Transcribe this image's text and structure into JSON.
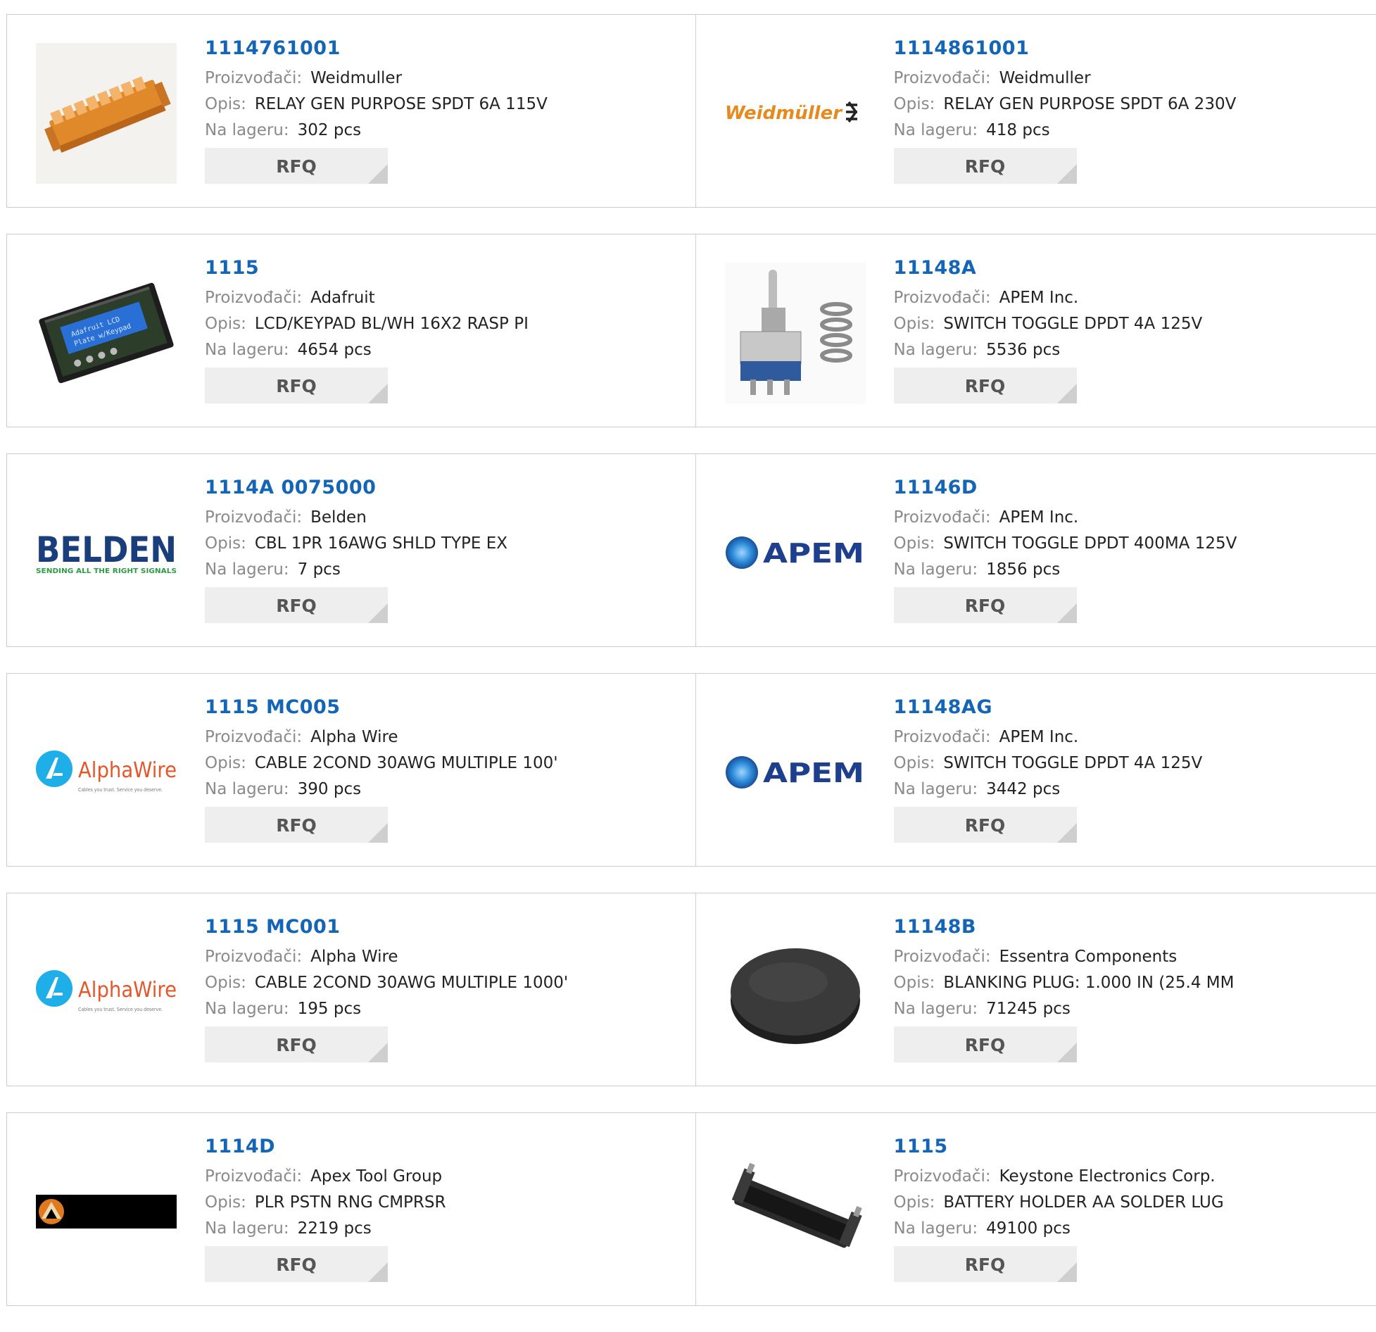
{
  "labels": {
    "manufacturer": "Proizvođači:",
    "description": "Opis:",
    "stock": "Na lageru:",
    "rfq": "RFQ"
  },
  "logos": {
    "weidmuller": "Weidmüller",
    "belden": "BELDEN",
    "belden_tagline": "SENDING ALL THE RIGHT SIGNALS",
    "apem": "APEM",
    "alphawire": "AlphaWire",
    "alphawire_tagline": "Cables you trust. Service you deserve."
  },
  "colors": {
    "part_number": "#1565b7",
    "label": "#8a8a8a",
    "rfq_bg": "#eeeeee",
    "border": "#cccccc"
  },
  "rows": [
    [
      {
        "part": "1114761001",
        "manufacturer": "Weidmuller",
        "description": "RELAY GEN PURPOSE SPDT 6A 115V",
        "stock": "302 pcs",
        "thumb": "relay-module-image"
      },
      {
        "part": "1114861001",
        "manufacturer": "Weidmuller",
        "description": "RELAY GEN PURPOSE SPDT 6A 230V",
        "stock": "418 pcs",
        "thumb": "weidmuller-logo"
      }
    ],
    [
      {
        "part": "1115",
        "manufacturer": "Adafruit",
        "description": "LCD/KEYPAD BL/WH 16X2 RASP PI",
        "stock": "4654 pcs",
        "thumb": "lcd-keypad-image"
      },
      {
        "part": "11148A",
        "manufacturer": "APEM Inc.",
        "description": "SWITCH TOGGLE DPDT 4A 125V",
        "stock": "5536 pcs",
        "thumb": "toggle-switch-image"
      }
    ],
    [
      {
        "part": "1114A 0075000",
        "manufacturer": "Belden",
        "description": "CBL 1PR 16AWG SHLD TYPE EX",
        "stock": "7 pcs",
        "thumb": "belden-logo"
      },
      {
        "part": "11146D",
        "manufacturer": "APEM Inc.",
        "description": "SWITCH TOGGLE DPDT 400MA 125V",
        "stock": "1856 pcs",
        "thumb": "apem-logo"
      }
    ],
    [
      {
        "part": "1115 MC005",
        "manufacturer": "Alpha Wire",
        "description": "CABLE 2COND 30AWG MULTIPLE 100'",
        "stock": "390 pcs",
        "thumb": "alphawire-logo"
      },
      {
        "part": "11148AG",
        "manufacturer": "APEM Inc.",
        "description": "SWITCH TOGGLE DPDT 4A 125V",
        "stock": "3442 pcs",
        "thumb": "apem-logo"
      }
    ],
    [
      {
        "part": "1115 MC001",
        "manufacturer": "Alpha Wire",
        "description": "CABLE 2COND 30AWG MULTIPLE 1000'",
        "stock": "195 pcs",
        "thumb": "alphawire-logo"
      },
      {
        "part": "11148B",
        "manufacturer": "Essentra Components",
        "description": "BLANKING PLUG: 1.000 IN (25.4 MM",
        "stock": "71245 pcs",
        "thumb": "blanking-plug-image"
      }
    ],
    [
      {
        "part": "1114D",
        "manufacturer": "Apex Tool Group",
        "description": "PLR PSTN RNG CMPRSR",
        "stock": "2219 pcs",
        "thumb": "apex-tool-logo"
      },
      {
        "part": "1115",
        "manufacturer": "Keystone Electronics Corp.",
        "description": "BATTERY HOLDER AA SOLDER LUG",
        "stock": "49100 pcs",
        "thumb": "battery-holder-image"
      }
    ]
  ]
}
